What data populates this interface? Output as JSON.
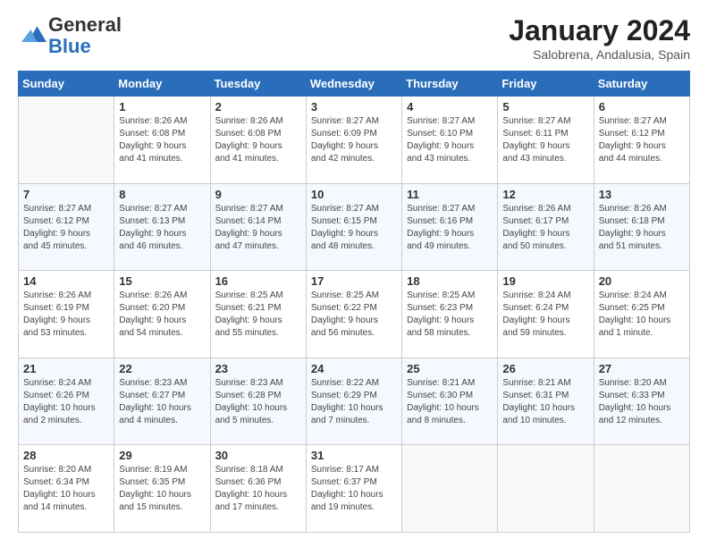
{
  "header": {
    "logo_general": "General",
    "logo_blue": "Blue",
    "month_title": "January 2024",
    "location": "Salobrena, Andalusia, Spain"
  },
  "weekdays": [
    "Sunday",
    "Monday",
    "Tuesday",
    "Wednesday",
    "Thursday",
    "Friday",
    "Saturday"
  ],
  "weeks": [
    [
      {
        "day": "",
        "info": ""
      },
      {
        "day": "1",
        "info": "Sunrise: 8:26 AM\nSunset: 6:08 PM\nDaylight: 9 hours\nand 41 minutes."
      },
      {
        "day": "2",
        "info": "Sunrise: 8:26 AM\nSunset: 6:08 PM\nDaylight: 9 hours\nand 41 minutes."
      },
      {
        "day": "3",
        "info": "Sunrise: 8:27 AM\nSunset: 6:09 PM\nDaylight: 9 hours\nand 42 minutes."
      },
      {
        "day": "4",
        "info": "Sunrise: 8:27 AM\nSunset: 6:10 PM\nDaylight: 9 hours\nand 43 minutes."
      },
      {
        "day": "5",
        "info": "Sunrise: 8:27 AM\nSunset: 6:11 PM\nDaylight: 9 hours\nand 43 minutes."
      },
      {
        "day": "6",
        "info": "Sunrise: 8:27 AM\nSunset: 6:12 PM\nDaylight: 9 hours\nand 44 minutes."
      }
    ],
    [
      {
        "day": "7",
        "info": "Sunrise: 8:27 AM\nSunset: 6:12 PM\nDaylight: 9 hours\nand 45 minutes."
      },
      {
        "day": "8",
        "info": "Sunrise: 8:27 AM\nSunset: 6:13 PM\nDaylight: 9 hours\nand 46 minutes."
      },
      {
        "day": "9",
        "info": "Sunrise: 8:27 AM\nSunset: 6:14 PM\nDaylight: 9 hours\nand 47 minutes."
      },
      {
        "day": "10",
        "info": "Sunrise: 8:27 AM\nSunset: 6:15 PM\nDaylight: 9 hours\nand 48 minutes."
      },
      {
        "day": "11",
        "info": "Sunrise: 8:27 AM\nSunset: 6:16 PM\nDaylight: 9 hours\nand 49 minutes."
      },
      {
        "day": "12",
        "info": "Sunrise: 8:26 AM\nSunset: 6:17 PM\nDaylight: 9 hours\nand 50 minutes."
      },
      {
        "day": "13",
        "info": "Sunrise: 8:26 AM\nSunset: 6:18 PM\nDaylight: 9 hours\nand 51 minutes."
      }
    ],
    [
      {
        "day": "14",
        "info": "Sunrise: 8:26 AM\nSunset: 6:19 PM\nDaylight: 9 hours\nand 53 minutes."
      },
      {
        "day": "15",
        "info": "Sunrise: 8:26 AM\nSunset: 6:20 PM\nDaylight: 9 hours\nand 54 minutes."
      },
      {
        "day": "16",
        "info": "Sunrise: 8:25 AM\nSunset: 6:21 PM\nDaylight: 9 hours\nand 55 minutes."
      },
      {
        "day": "17",
        "info": "Sunrise: 8:25 AM\nSunset: 6:22 PM\nDaylight: 9 hours\nand 56 minutes."
      },
      {
        "day": "18",
        "info": "Sunrise: 8:25 AM\nSunset: 6:23 PM\nDaylight: 9 hours\nand 58 minutes."
      },
      {
        "day": "19",
        "info": "Sunrise: 8:24 AM\nSunset: 6:24 PM\nDaylight: 9 hours\nand 59 minutes."
      },
      {
        "day": "20",
        "info": "Sunrise: 8:24 AM\nSunset: 6:25 PM\nDaylight: 10 hours\nand 1 minute."
      }
    ],
    [
      {
        "day": "21",
        "info": "Sunrise: 8:24 AM\nSunset: 6:26 PM\nDaylight: 10 hours\nand 2 minutes."
      },
      {
        "day": "22",
        "info": "Sunrise: 8:23 AM\nSunset: 6:27 PM\nDaylight: 10 hours\nand 4 minutes."
      },
      {
        "day": "23",
        "info": "Sunrise: 8:23 AM\nSunset: 6:28 PM\nDaylight: 10 hours\nand 5 minutes."
      },
      {
        "day": "24",
        "info": "Sunrise: 8:22 AM\nSunset: 6:29 PM\nDaylight: 10 hours\nand 7 minutes."
      },
      {
        "day": "25",
        "info": "Sunrise: 8:21 AM\nSunset: 6:30 PM\nDaylight: 10 hours\nand 8 minutes."
      },
      {
        "day": "26",
        "info": "Sunrise: 8:21 AM\nSunset: 6:31 PM\nDaylight: 10 hours\nand 10 minutes."
      },
      {
        "day": "27",
        "info": "Sunrise: 8:20 AM\nSunset: 6:33 PM\nDaylight: 10 hours\nand 12 minutes."
      }
    ],
    [
      {
        "day": "28",
        "info": "Sunrise: 8:20 AM\nSunset: 6:34 PM\nDaylight: 10 hours\nand 14 minutes."
      },
      {
        "day": "29",
        "info": "Sunrise: 8:19 AM\nSunset: 6:35 PM\nDaylight: 10 hours\nand 15 minutes."
      },
      {
        "day": "30",
        "info": "Sunrise: 8:18 AM\nSunset: 6:36 PM\nDaylight: 10 hours\nand 17 minutes."
      },
      {
        "day": "31",
        "info": "Sunrise: 8:17 AM\nSunset: 6:37 PM\nDaylight: 10 hours\nand 19 minutes."
      },
      {
        "day": "",
        "info": ""
      },
      {
        "day": "",
        "info": ""
      },
      {
        "day": "",
        "info": ""
      }
    ]
  ]
}
